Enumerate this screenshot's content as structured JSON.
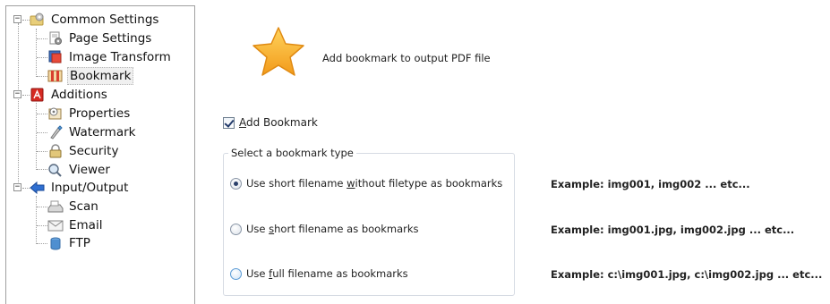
{
  "tree": {
    "items": [
      {
        "label": "Common Settings",
        "icon": "gear-folder-icon"
      },
      {
        "label": "Page Settings",
        "icon": "page-settings-icon"
      },
      {
        "label": "Image Transform",
        "icon": "image-transform-icon"
      },
      {
        "label": "Bookmark",
        "icon": "bookmark-icon",
        "selected": true
      },
      {
        "label": "Additions",
        "icon": "pdf-icon"
      },
      {
        "label": "Properties",
        "icon": "properties-icon"
      },
      {
        "label": "Watermark",
        "icon": "watermark-icon"
      },
      {
        "label": "Security",
        "icon": "lock-icon"
      },
      {
        "label": "Viewer",
        "icon": "viewer-icon"
      },
      {
        "label": "Input/Output",
        "icon": "arrow-icon"
      },
      {
        "label": "Scan",
        "icon": "scanner-icon"
      },
      {
        "label": "Email",
        "icon": "email-icon"
      },
      {
        "label": "FTP",
        "icon": "ftp-icon"
      }
    ],
    "expander_symbol": "−"
  },
  "header": {
    "text": "Add bookmark to output PDF file",
    "icon": "star-icon"
  },
  "add_bookmark": {
    "label_hotkey": "A",
    "label_rest": "dd Bookmark",
    "checked": true
  },
  "group": {
    "title": "Select a bookmark type",
    "options": [
      {
        "pre": "Use short filename ",
        "hotkey": "w",
        "post": "ithout filetype as bookmarks",
        "checked": true,
        "example": "Example:  img001, img002 ... etc..."
      },
      {
        "pre": "Use ",
        "hotkey": "s",
        "post": "hort filename as bookmarks",
        "checked": false,
        "example": "Example:  img001.jpg, img002.jpg ... etc..."
      },
      {
        "pre": "Use ",
        "hotkey": "f",
        "post": "ull filename as bookmarks",
        "checked": false,
        "example": "Example:  c:\\img001.jpg, c:\\img002.jpg ... etc..."
      }
    ]
  },
  "colors": {
    "accent": "#2a3f6a",
    "star": "#f7a828",
    "group_border": "#d6dbe3"
  }
}
